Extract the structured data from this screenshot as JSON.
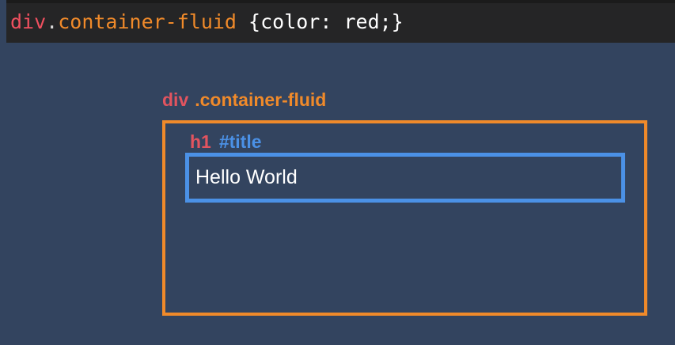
{
  "code_bar": {
    "tag": "div",
    "dot": ".",
    "class_name": "container-fluid",
    "rule": " {color: red;}"
  },
  "outer_element": {
    "tag": "div",
    "selector": ".container-fluid"
  },
  "inner_element": {
    "tag": "h1",
    "selector": "#title",
    "content": "Hello World"
  },
  "colors": {
    "background": "#33445f",
    "code_bar": "#252526",
    "tag": "#e2545f",
    "class_selector": "#f08a2a",
    "id_selector": "#4b91e6",
    "text": "#ffffff"
  }
}
